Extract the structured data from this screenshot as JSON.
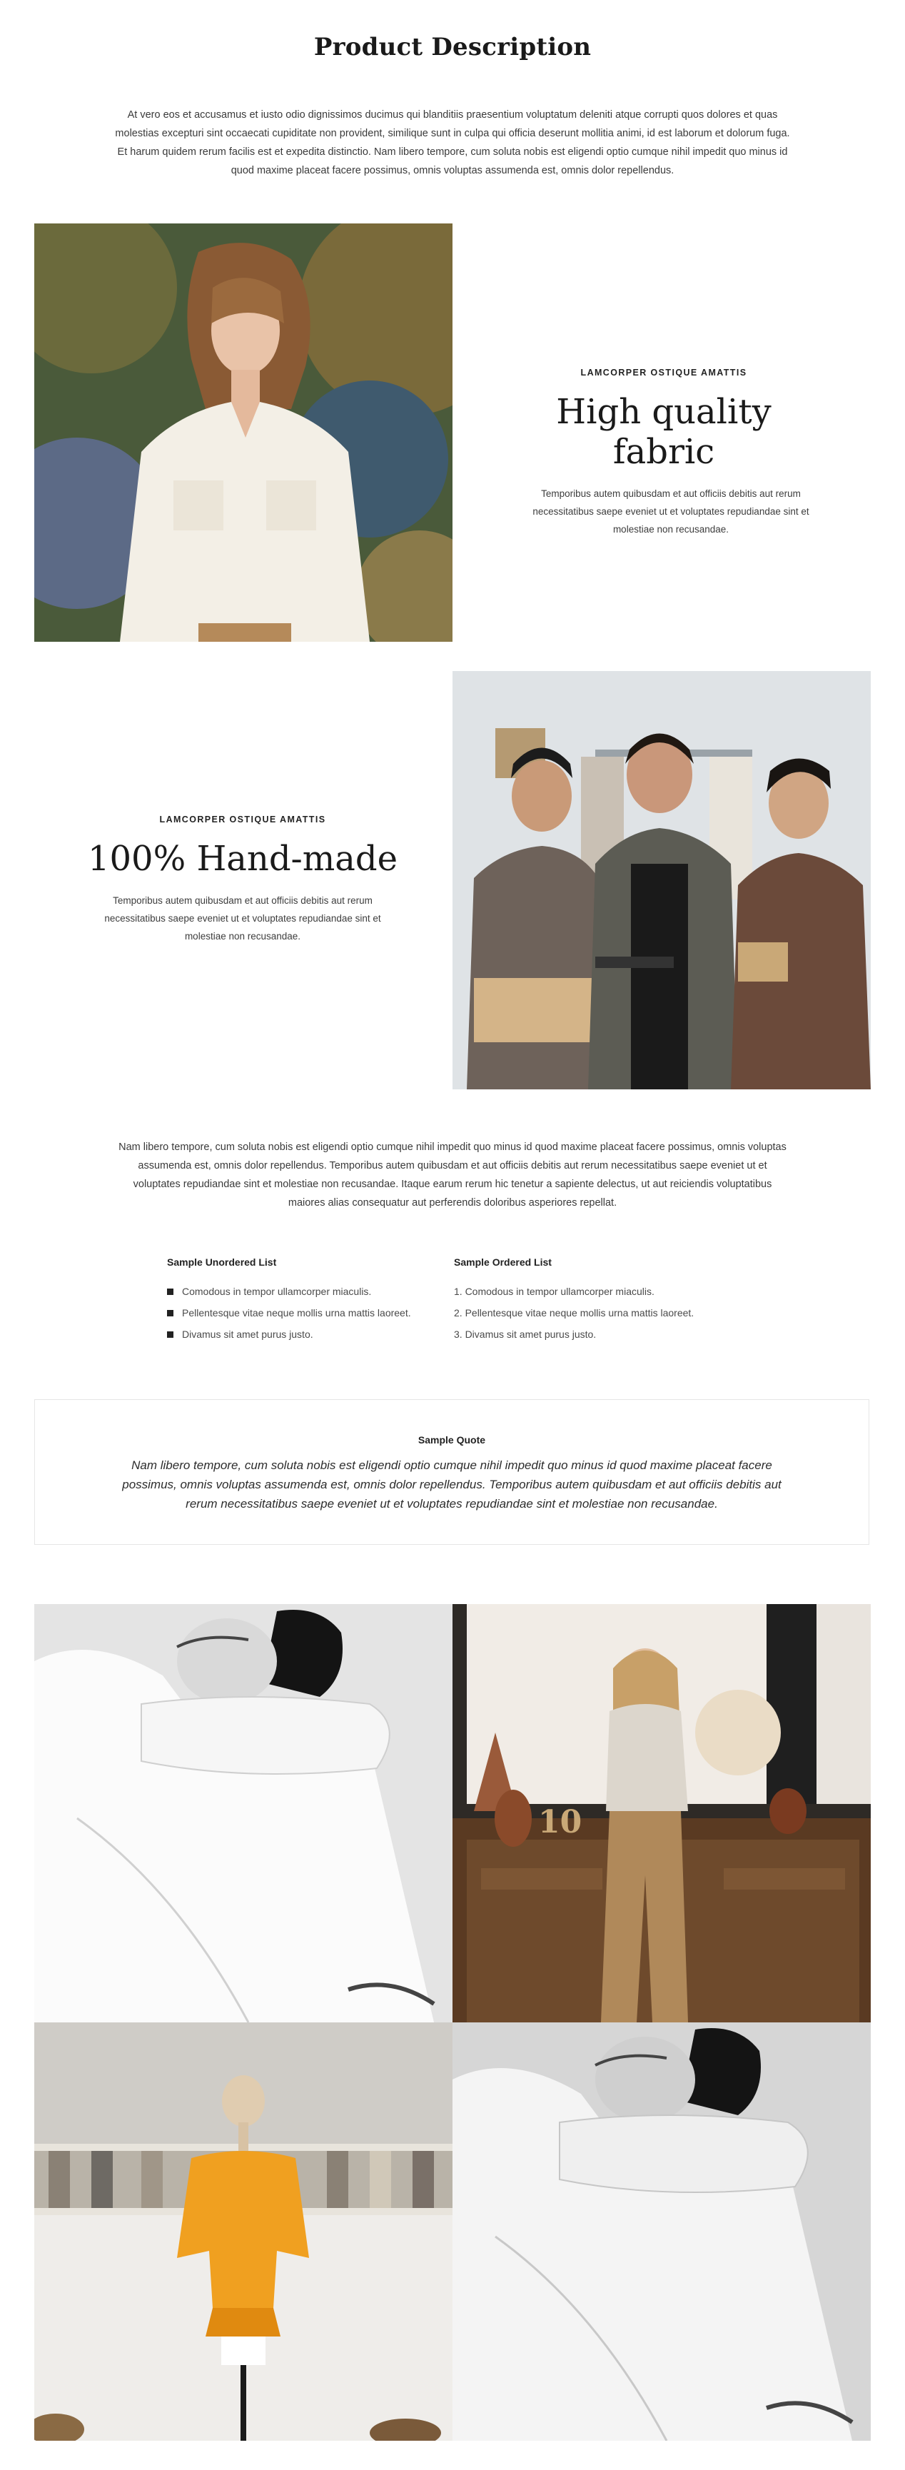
{
  "page": {
    "title": "Product Description",
    "intro": "At vero eos et accusamus et iusto odio dignissimos ducimus qui blanditiis praesentium voluptatum deleniti atque corrupti quos dolores et quas molestias excepturi sint occaecati cupiditate non provident, similique sunt in culpa qui officia deserunt mollitia animi, id est laborum et dolorum fuga. Et harum quidem rerum facilis est et expedita distinctio. Nam libero tempore, cum soluta nobis est eligendi optio cumque nihil impedit quo minus id quod maxime placeat facere possimus, omnis voluptas assumenda est, omnis dolor repellendus."
  },
  "feature1": {
    "eyebrow": "LAMCORPER OSTIQUE AMATTIS",
    "title": "High quality fabric",
    "text": "Temporibus autem quibusdam et aut officiis debitis aut rerum necessitatibus saepe eveniet ut et voluptates repudiandae sint et molestiae non recusandae."
  },
  "feature2": {
    "eyebrow": "LAMCORPER OSTIQUE AMATTIS",
    "title": "100% Hand-made",
    "text": "Temporibus autem quibusdam et aut officiis debitis aut rerum necessitatibus saepe eveniet ut et voluptates repudiandae sint et molestiae non recusandae."
  },
  "body": {
    "paragraph": "Nam libero tempore, cum soluta nobis est eligendi optio cumque nihil impedit quo minus id quod maxime placeat facere possimus, omnis voluptas assumenda est, omnis dolor repellendus. Temporibus autem quibusdam et aut officiis debitis aut rerum necessitatibus saepe eveniet ut et voluptates repudiandae sint et molestiae non recusandae. Itaque earum rerum hic tenetur a sapiente delectus, ut aut reiciendis voluptatibus maiores alias consequatur aut perferendis doloribus asperiores repellat."
  },
  "unordered_list": {
    "title": "Sample Unordered List",
    "items": [
      "Comodous in tempor ullamcorper miaculis.",
      "Pellentesque vitae neque mollis urna mattis laoreet.",
      "Divamus sit amet purus justo."
    ]
  },
  "ordered_list": {
    "title": "Sample Ordered List",
    "items": [
      "1. Comodous in tempor ullamcorper miaculis.",
      "2. Pellentesque vitae neque mollis urna mattis laoreet.",
      "3. Divamus sit amet purus justo."
    ]
  },
  "quote": {
    "title": "Sample Quote",
    "text": "Nam libero tempore, cum soluta nobis est eligendi optio cumque nihil impedit quo minus id quod maxime placeat facere possimus, omnis voluptas assumenda est, omnis dolor repellendus. Temporibus autem quibusdam et aut officiis debitis aut rerum necessitatibus saepe eveniet ut et voluptates repudiandae sint et molestiae non recusandae."
  },
  "gallery_badge": "10"
}
